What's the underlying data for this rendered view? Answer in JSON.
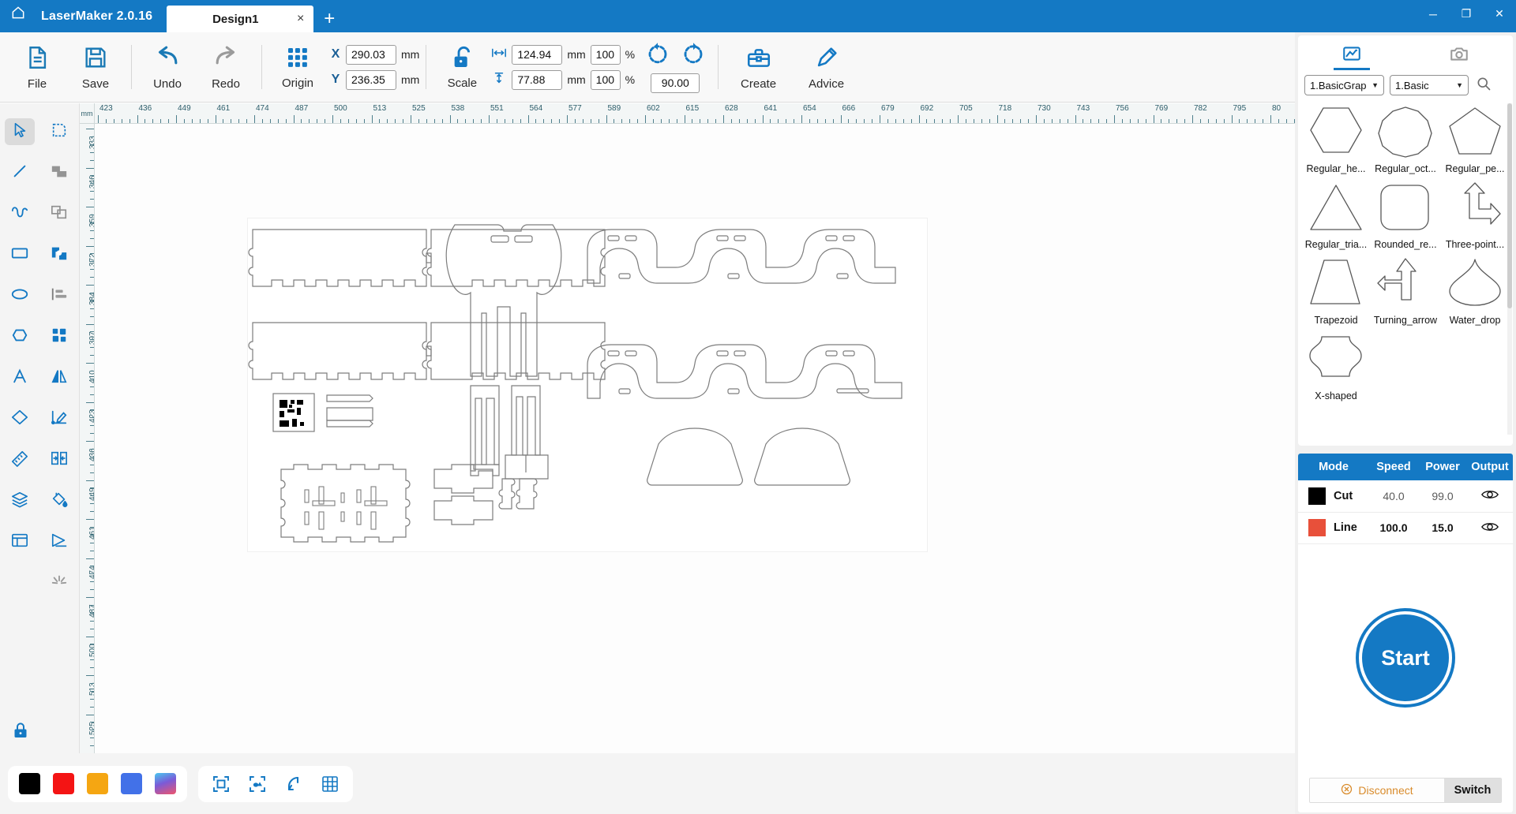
{
  "titlebar": {
    "home_icon": "home-icon",
    "app_title": "LaserMaker 2.0.16",
    "tabs": [
      {
        "label": "Design1",
        "close": "×"
      }
    ],
    "new_tab": "+",
    "window_controls": {
      "minimize": "─",
      "maximize": "❐",
      "close": "✕"
    },
    "bg_color": "#1479c4"
  },
  "ribbon": {
    "buttons": [
      {
        "name": "file",
        "label": "File",
        "icon": "document-icon"
      },
      {
        "name": "save",
        "label": "Save",
        "icon": "floppy-disk-icon"
      },
      {
        "name": "undo",
        "label": "Undo",
        "icon": "undo-arrow-icon"
      },
      {
        "name": "redo",
        "label": "Redo",
        "icon": "redo-arrow-icon"
      },
      {
        "name": "origin",
        "label": "Origin",
        "icon": "origin-grid-icon"
      },
      {
        "name": "scale",
        "label": "Scale",
        "icon": "unlock-icon"
      },
      {
        "name": "create",
        "label": "Create",
        "icon": "toolbox-icon"
      },
      {
        "name": "advice",
        "label": "Advice",
        "icon": "pen-idea-icon"
      }
    ],
    "position": {
      "x_label": "X",
      "x_value": "290.03",
      "x_unit": "mm",
      "y_label": "Y",
      "y_value": "236.35",
      "y_unit": "mm"
    },
    "size": {
      "width_value": "124.94",
      "width_unit": "mm",
      "width_pct": "100",
      "pct_sign": "%",
      "height_value": "77.88",
      "height_unit": "mm",
      "height_pct": "100"
    },
    "rotate": {
      "ccw_icon": "rotate-counterclockwise-icon",
      "cw_icon": "rotate-clockwise-icon",
      "angle_value": "90.00"
    }
  },
  "left_toolbar": {
    "tools": [
      {
        "name": "select-tool",
        "icon": "cursor-arrow-icon",
        "active": true
      },
      {
        "name": "node-edit-tool",
        "icon": "node-edit-icon",
        "active": false
      },
      {
        "name": "line-tool",
        "icon": "line-icon",
        "active": false
      },
      {
        "name": "union-tool",
        "icon": "union-shapes-icon",
        "active": false
      },
      {
        "name": "curve-tool",
        "icon": "curve-wave-icon",
        "active": false
      },
      {
        "name": "intersect-tool",
        "icon": "intersect-shapes-icon",
        "active": false
      },
      {
        "name": "rectangle-tool",
        "icon": "rectangle-icon",
        "active": false
      },
      {
        "name": "subtract-tool",
        "icon": "subtract-shapes-icon",
        "active": false
      },
      {
        "name": "ellipse-tool",
        "icon": "ellipse-icon",
        "active": false
      },
      {
        "name": "align-tool",
        "icon": "align-left-icon",
        "active": false
      },
      {
        "name": "polygon-tool",
        "icon": "hexagon-icon",
        "active": false
      },
      {
        "name": "array-tool",
        "icon": "grid-array-icon",
        "active": false
      },
      {
        "name": "text-tool",
        "icon": "text-a-icon",
        "active": false
      },
      {
        "name": "mirror-tool",
        "icon": "mirror-flip-icon",
        "active": false
      },
      {
        "name": "eraser-tool",
        "icon": "eraser-icon",
        "active": false
      },
      {
        "name": "measure-angle-tool",
        "icon": "angle-pen-icon",
        "active": false
      },
      {
        "name": "ruler-tool",
        "icon": "ruler-icon",
        "active": false
      },
      {
        "name": "distribute-tool",
        "icon": "distribute-horizontal-icon",
        "active": false
      },
      {
        "name": "layers-tool",
        "icon": "layers-stack-icon",
        "active": false
      },
      {
        "name": "fill-tool",
        "icon": "paint-bucket-icon",
        "active": false
      },
      {
        "name": "frame-tool",
        "icon": "frame-layout-icon",
        "active": false
      },
      {
        "name": "offset-tool",
        "icon": "offset-path-icon",
        "active": false
      },
      {
        "name": "explode-tool",
        "icon": "burst-icon",
        "active": false
      }
    ],
    "lock": {
      "name": "lock-canvas",
      "icon": "padlock-icon"
    }
  },
  "rulers": {
    "unit": "mm",
    "h_labels": [
      "423",
      "436",
      "449",
      "461",
      "474",
      "487",
      "500",
      "513",
      "525",
      "538",
      "551",
      "564",
      "577",
      "589",
      "602",
      "615",
      "628",
      "641",
      "654",
      "666",
      "679",
      "692",
      "705",
      "718",
      "730",
      "743",
      "756",
      "769",
      "782",
      "795",
      "80"
    ],
    "v_labels": [
      "333",
      "346",
      "359",
      "372",
      "384",
      "397",
      "410",
      "423",
      "436",
      "449",
      "461",
      "474",
      "487",
      "500",
      "513",
      "525"
    ]
  },
  "bottombar": {
    "swatches": [
      {
        "name": "color-black",
        "color": "#000000"
      },
      {
        "name": "color-red",
        "color": "#f41414"
      },
      {
        "name": "color-amber",
        "color": "#f5a612"
      },
      {
        "name": "color-blue",
        "color": "#4271e8"
      },
      {
        "name": "color-gradient",
        "color": "linear-gradient(160deg,#49c9f0,#7a5bd8 45%,#f0556b)"
      }
    ],
    "tools": [
      {
        "name": "fit-to-page",
        "icon": "fit-frame-icon"
      },
      {
        "name": "fit-selection",
        "icon": "fit-selection-icon"
      },
      {
        "name": "magnet-snap",
        "icon": "magnet-icon"
      },
      {
        "name": "show-grid",
        "icon": "grid-icon"
      }
    ]
  },
  "right_panel": {
    "tabs": [
      {
        "name": "library-tab",
        "icon": "picture-graph-icon",
        "active": true
      },
      {
        "name": "camera-tab",
        "icon": "camera-icon",
        "active": false
      }
    ],
    "category_select": {
      "value": "1.BasicGrap",
      "caret": "▼"
    },
    "subcategory_select": {
      "value": "1.Basic",
      "caret": "▼"
    },
    "search_icon": "search-icon",
    "shapes": [
      {
        "name": "Regular_he...",
        "icon": "hexagon-shape"
      },
      {
        "name": "Regular_oct...",
        "icon": "decagon-shape"
      },
      {
        "name": "Regular_pe...",
        "icon": "pentagon-shape"
      },
      {
        "name": "Regular_tria...",
        "icon": "triangle-shape"
      },
      {
        "name": "Rounded_re...",
        "icon": "rounded-rect-shape"
      },
      {
        "name": "Three-point...",
        "icon": "three-point-arrow-shape"
      },
      {
        "name": "Trapezoid",
        "icon": "trapezoid-shape"
      },
      {
        "name": "Turning_arrow",
        "icon": "turning-arrow-shape"
      },
      {
        "name": "Water_drop",
        "icon": "water-drop-shape"
      },
      {
        "name": "X-shaped",
        "icon": "x-shaped-shape"
      }
    ],
    "layer_table": {
      "headers": [
        "Mode",
        "Speed",
        "Power",
        "Output"
      ],
      "rows": [
        {
          "color": "#000000",
          "mode": "Cut",
          "speed": "40.0",
          "power": "99.0",
          "output_icon": "eye-icon",
          "selected": false
        },
        {
          "color": "#e8503a",
          "mode": "Line",
          "speed": "100.0",
          "power": "15.0",
          "output_icon": "eye-icon",
          "selected": true
        }
      ]
    },
    "start_button": {
      "label": "Start",
      "color": "#1479c4"
    },
    "connection": {
      "disconnect_label": "Disconnect",
      "disconnect_icon": "circle-x-icon",
      "switch_label": "Switch"
    }
  }
}
